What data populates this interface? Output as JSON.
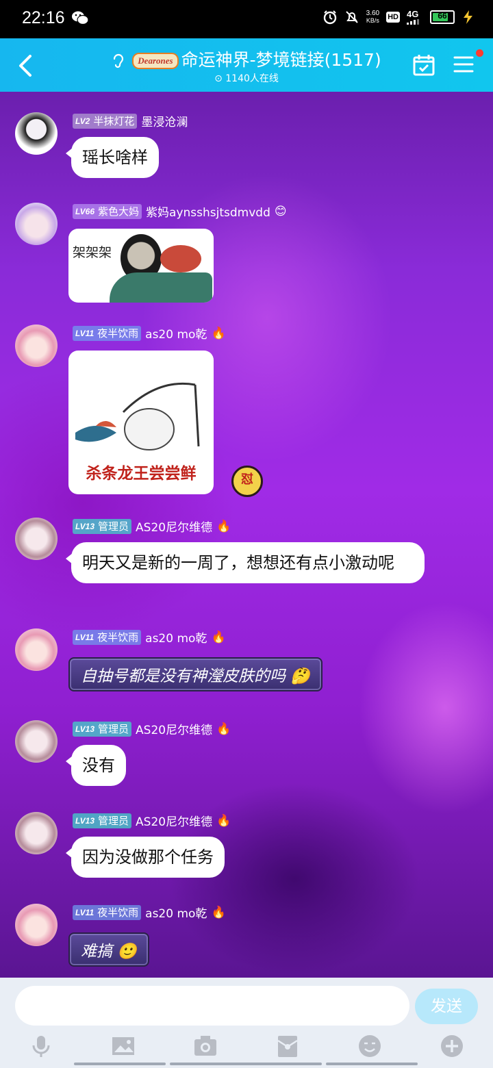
{
  "status_bar": {
    "time": "22:16",
    "net_speed_value": "3.60",
    "net_speed_unit": "KB/s",
    "hd": "HD",
    "network": "4G",
    "battery": "66"
  },
  "header": {
    "brand": "Dearones",
    "title": "命运神界-梦境链接(1517)",
    "online": "1140人在线"
  },
  "messages": [
    {
      "level": "LV2",
      "title": "半抹灯花",
      "name": "墨浸沧澜",
      "text": "瑶长啥样"
    },
    {
      "level": "LV66",
      "title": "紫色大妈",
      "name": "紫妈aynsshsjtsdmvdd",
      "sticker_text": "架架架"
    },
    {
      "level": "LV11",
      "title": "夜半饮雨",
      "name": "as20 mo乾",
      "sticker_text": "杀条龙王尝尝鲜",
      "reaction": "怼"
    },
    {
      "level": "LV13",
      "title": "管理员",
      "name": "AS20尼尔维德",
      "text": "明天又是新的一周了，想想还有点小激动呢"
    },
    {
      "level": "LV11",
      "title": "夜半饮雨",
      "name": "as20 mo乾",
      "text": "自抽号都是没有神瀅皮肤的吗"
    },
    {
      "level": "LV13",
      "title": "管理员",
      "name": "AS20尼尔维德",
      "text": "没有"
    },
    {
      "level": "LV13",
      "title": "管理员",
      "name": "AS20尼尔维德",
      "text": "因为没做那个任务"
    },
    {
      "level": "LV11",
      "title": "夜半饮雨",
      "name": "as20 mo乾",
      "text": "难搞"
    }
  ],
  "input": {
    "placeholder": "",
    "send_label": "发送"
  },
  "toolbar_icons": [
    "microphone-icon",
    "image-icon",
    "camera-icon",
    "red-packet-icon",
    "emoji-icon",
    "plus-icon"
  ],
  "colors": {
    "header": "#16b7ef",
    "send_button": "#b7e8fb",
    "chat_bg": "#8a2bd8"
  }
}
